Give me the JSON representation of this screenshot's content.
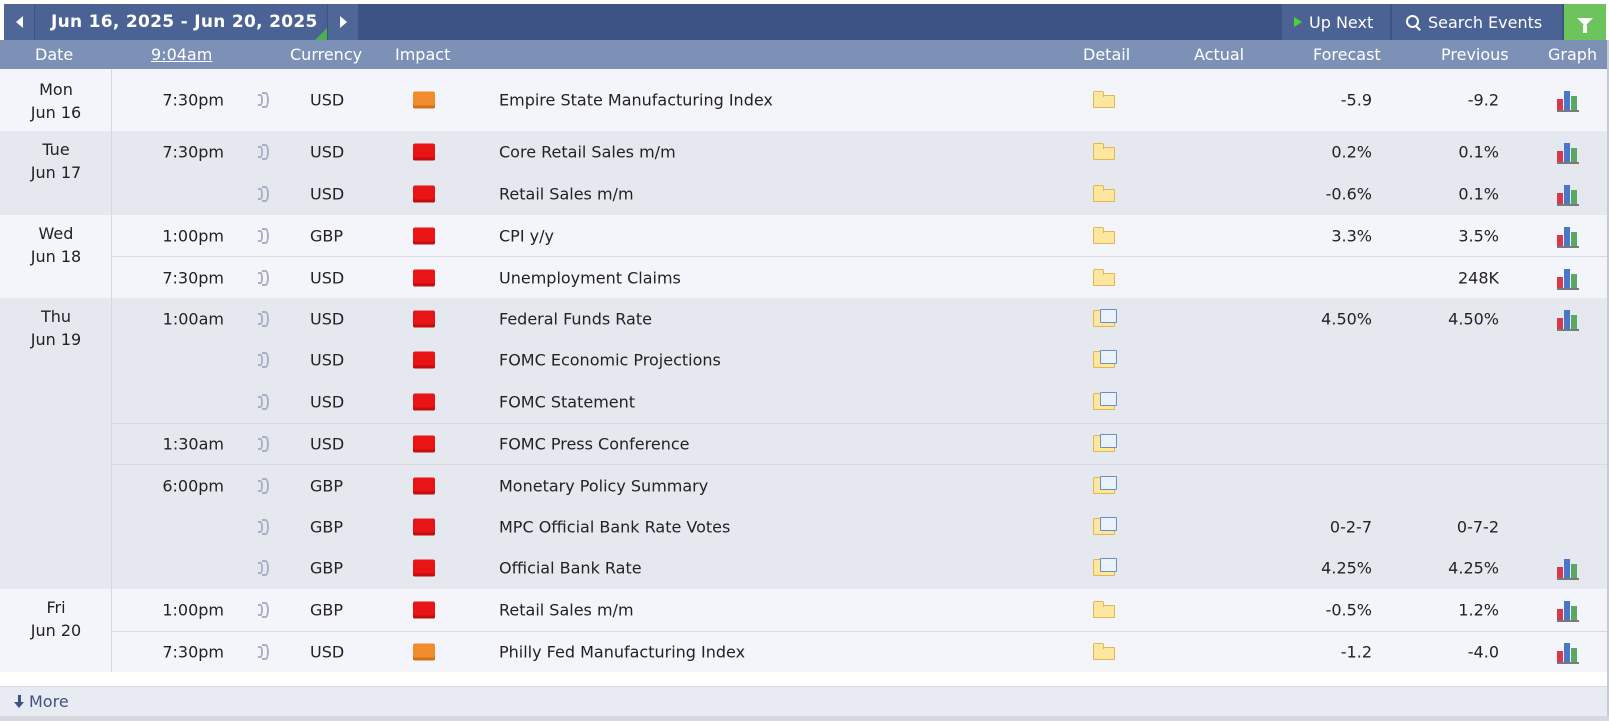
{
  "nav": {
    "date_range": "Jun 16, 2025 - Jun 20, 2025",
    "up_next_label": "Up Next",
    "search_label": "Search Events",
    "accent_color": "#3c5383",
    "filter_color": "#6dc35c"
  },
  "columns": {
    "date": "Date",
    "time": "9:04am",
    "currency": "Currency",
    "impact": "Impact",
    "detail": "Detail",
    "actual": "Actual",
    "forecast": "Forecast",
    "previous": "Previous",
    "graph": "Graph"
  },
  "days": [
    {
      "weekday": "Mon",
      "date": "Jun 16"
    },
    {
      "weekday": "Tue",
      "date": "Jun 17"
    },
    {
      "weekday": "Wed",
      "date": "Jun 18"
    },
    {
      "weekday": "Thu",
      "date": "Jun 19"
    },
    {
      "weekday": "Fri",
      "date": "Jun 20"
    }
  ],
  "events": [
    {
      "time": "7:30pm",
      "currency": "USD",
      "impact": "medium",
      "event": "Empire State Manufacturing Index",
      "detail_icon": "folder-icon",
      "actual": "",
      "forecast": "-5.9",
      "previous": "-9.2",
      "graph": true,
      "live": true
    },
    {
      "time": "7:30pm",
      "currency": "USD",
      "impact": "high",
      "event": "Core Retail Sales m/m",
      "detail_icon": "folder-icon",
      "actual": "",
      "forecast": "0.2%",
      "previous": "0.1%",
      "graph": true
    },
    {
      "time": "",
      "currency": "USD",
      "impact": "high",
      "event": "Retail Sales m/m",
      "detail_icon": "folder-icon",
      "actual": "",
      "forecast": "-0.6%",
      "previous": "0.1%",
      "graph": true
    },
    {
      "time": "1:00pm",
      "currency": "GBP",
      "impact": "high",
      "event": "CPI y/y",
      "detail_icon": "folder-icon",
      "actual": "",
      "forecast": "3.3%",
      "previous": "3.5%",
      "graph": true
    },
    {
      "time": "7:30pm",
      "currency": "USD",
      "impact": "high",
      "event": "Unemployment Claims",
      "detail_icon": "folder-icon",
      "actual": "",
      "forecast": "",
      "previous": "248K",
      "graph": true
    },
    {
      "time": "1:00am",
      "currency": "USD",
      "impact": "high",
      "event": "Federal Funds Rate",
      "detail_icon": "folder-news-icon",
      "actual": "",
      "forecast": "4.50%",
      "previous": "4.50%",
      "graph": true
    },
    {
      "time": "",
      "currency": "USD",
      "impact": "high",
      "event": "FOMC Economic Projections",
      "detail_icon": "folder-news-icon",
      "actual": "",
      "forecast": "",
      "previous": "",
      "graph": false
    },
    {
      "time": "",
      "currency": "USD",
      "impact": "high",
      "event": "FOMC Statement",
      "detail_icon": "folder-news-icon",
      "actual": "",
      "forecast": "",
      "previous": "",
      "graph": false
    },
    {
      "time": "1:30am",
      "currency": "USD",
      "impact": "high",
      "event": "FOMC Press Conference",
      "detail_icon": "folder-news-icon",
      "actual": "",
      "forecast": "",
      "previous": "",
      "graph": false
    },
    {
      "time": "6:00pm",
      "currency": "GBP",
      "impact": "high",
      "event": "Monetary Policy Summary",
      "detail_icon": "folder-news-icon",
      "actual": "",
      "forecast": "",
      "previous": "",
      "graph": false
    },
    {
      "time": "",
      "currency": "GBP",
      "impact": "high",
      "event": "MPC Official Bank Rate Votes",
      "detail_icon": "folder-news-icon",
      "actual": "",
      "forecast": "0-2-7",
      "previous": "0-7-2",
      "graph": false
    },
    {
      "time": "",
      "currency": "GBP",
      "impact": "high",
      "event": "Official Bank Rate",
      "detail_icon": "folder-news-icon",
      "actual": "",
      "forecast": "4.25%",
      "previous": "4.25%",
      "graph": true
    },
    {
      "time": "1:00pm",
      "currency": "GBP",
      "impact": "high",
      "event": "Retail Sales m/m",
      "detail_icon": "folder-icon",
      "actual": "",
      "forecast": "-0.5%",
      "previous": "1.2%",
      "graph": true
    },
    {
      "time": "7:30pm",
      "currency": "USD",
      "impact": "medium",
      "event": "Philly Fed Manufacturing Index",
      "detail_icon": "folder-icon",
      "actual": "",
      "forecast": "-1.2",
      "previous": "-4.0",
      "graph": true
    }
  ],
  "footer": {
    "more_label": "More"
  },
  "impact_colors": {
    "high": "#e81416",
    "medium": "#f28a2e"
  }
}
